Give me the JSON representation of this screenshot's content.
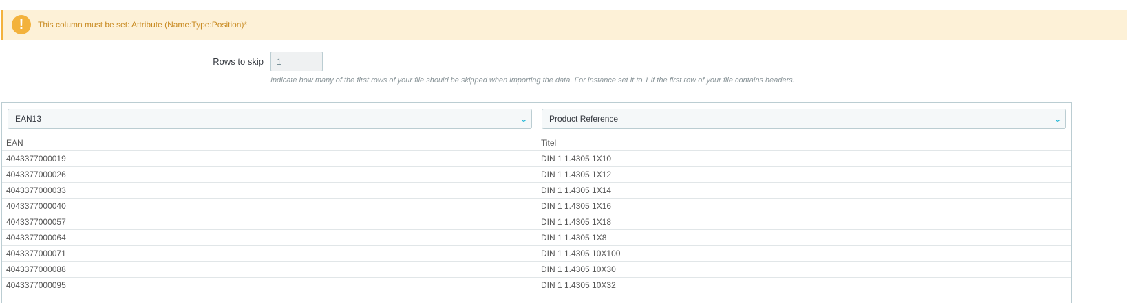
{
  "alert": {
    "text": "This column must be set: Attribute (Name:Type:Position)*",
    "icon": "exclamation-icon",
    "accent": "#f3b23c"
  },
  "skip": {
    "label": "Rows to skip",
    "value": "1",
    "help": "Indicate how many of the first rows of your file should be skipped when importing the data. For instance set it to 1 if the first row of your file contains headers."
  },
  "columns": [
    {
      "mapping": "EAN13",
      "header": "EAN"
    },
    {
      "mapping": "Product Reference",
      "header": "Titel"
    }
  ],
  "rows": [
    [
      "4043377000019",
      "DIN 1 1.4305 1X10"
    ],
    [
      "4043377000026",
      "DIN 1 1.4305 1X12"
    ],
    [
      "4043377000033",
      "DIN 1 1.4305 1X14"
    ],
    [
      "4043377000040",
      "DIN 1 1.4305 1X16"
    ],
    [
      "4043377000057",
      "DIN 1 1.4305 1X18"
    ],
    [
      "4043377000064",
      "DIN 1 1.4305 1X8"
    ],
    [
      "4043377000071",
      "DIN 1 1.4305 10X100"
    ],
    [
      "4043377000088",
      "DIN 1 1.4305 10X30"
    ],
    [
      "4043377000095",
      "DIN 1 1.4305 10X32"
    ]
  ]
}
